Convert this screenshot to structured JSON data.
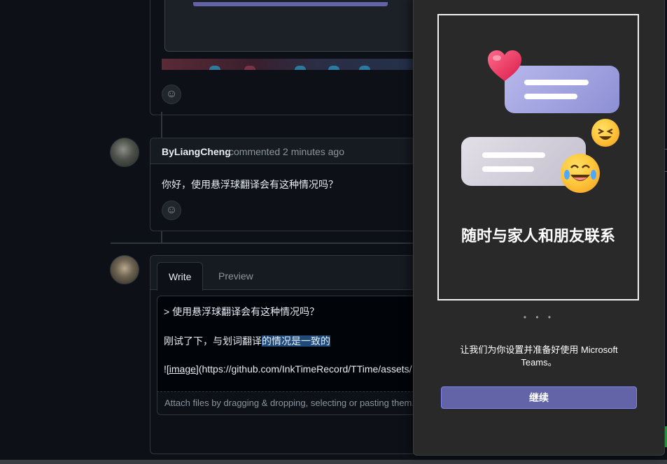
{
  "github": {
    "comment": {
      "author": "ByLiangCheng",
      "action": "commented",
      "time": "2 minutes ago",
      "body": "你好，使用悬浮球翻译会有这种情况吗？"
    },
    "editor": {
      "tabs": {
        "write": "Write",
        "preview": "Preview"
      },
      "line1": "> 使用悬浮球翻译会有这种情况吗？",
      "line2_plain": "刚试了下，与划词翻译",
      "line2_selected": "的情况是一致的",
      "line3_prefix": "!",
      "line3_link": "[image]",
      "line3_rest": "(https://github.com/InkTimeRecord/TTime/assets/",
      "attach_hint": "Attach files by dragging & dropping, selecting or pasting them."
    },
    "icons": {
      "reaction": "smiley-icon"
    }
  },
  "teams": {
    "headline": "随时与家人和朋友联系",
    "pager_dots": "• • •",
    "setup_text": "让我们为你设置并准备好使用 Microsoft Teams。",
    "continue_label": "继续",
    "colors": {
      "accent": "#6264a7",
      "panel": "#292929"
    }
  }
}
